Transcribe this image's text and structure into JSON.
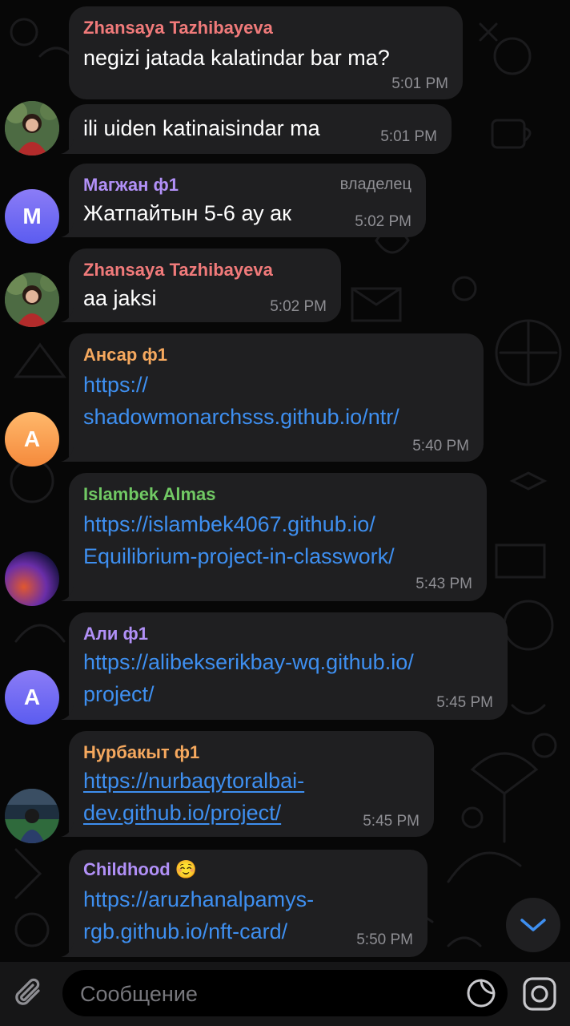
{
  "messages": [
    {
      "sender": "Zhansaya Tazhibayeva",
      "sender_color": "#f07a7a",
      "lines": [
        "negizi jatada kalatindar bar ma?"
      ],
      "time": "5:01 PM"
    },
    {
      "lines": [
        "ili uiden katinaisindar ma"
      ],
      "time": "5:01 PM"
    },
    {
      "sender": "Магжан ф1",
      "sender_color": "#b190f7",
      "role": "владелец",
      "lines": [
        "Жатпайтын 5-6 ау ак"
      ],
      "time": "5:02 PM",
      "avatar_letter": "M"
    },
    {
      "sender": "Zhansaya Tazhibayeva",
      "sender_color": "#f07a7a",
      "lines": [
        "aa jaksi"
      ],
      "time": "5:02 PM"
    },
    {
      "sender": "Ансар ф1",
      "sender_color": "#f5a85e",
      "lines": [
        "https://",
        "shadowmonarchsss.github.io/ntr/"
      ],
      "time": "5:40 PM",
      "avatar_letter": "A"
    },
    {
      "sender": "Islambek Almas",
      "sender_color": "#71c964",
      "lines": [
        "https://islambek4067.github.io/",
        "Equilibrium-project-in-classwork/"
      ],
      "time": "5:43 PM"
    },
    {
      "sender": "Али ф1",
      "sender_color": "#b190f7",
      "lines": [
        "https://alibekserikbay-wq.github.io/",
        "project/"
      ],
      "time": "5:45 PM",
      "avatar_letter": "A"
    },
    {
      "sender": "Нурбакыт ф1",
      "sender_color": "#f5a85e",
      "lines": [
        "https://nurbaqytoralbai-",
        "dev.github.io/project/"
      ],
      "time": "5:45 PM"
    },
    {
      "sender": "Childhood ☺️",
      "sender_color": "#b190f7",
      "lines": [
        "https://aruzhanalpamys-",
        "rgb.github.io/nft-card/"
      ],
      "time": "5:50 PM"
    }
  ],
  "composer": {
    "placeholder": "Сообщение"
  },
  "icons": {
    "attach": "paperclip-icon",
    "sticker": "sticker-icon",
    "camera": "camera-icon",
    "scroll_down": "chevron-down-icon"
  }
}
